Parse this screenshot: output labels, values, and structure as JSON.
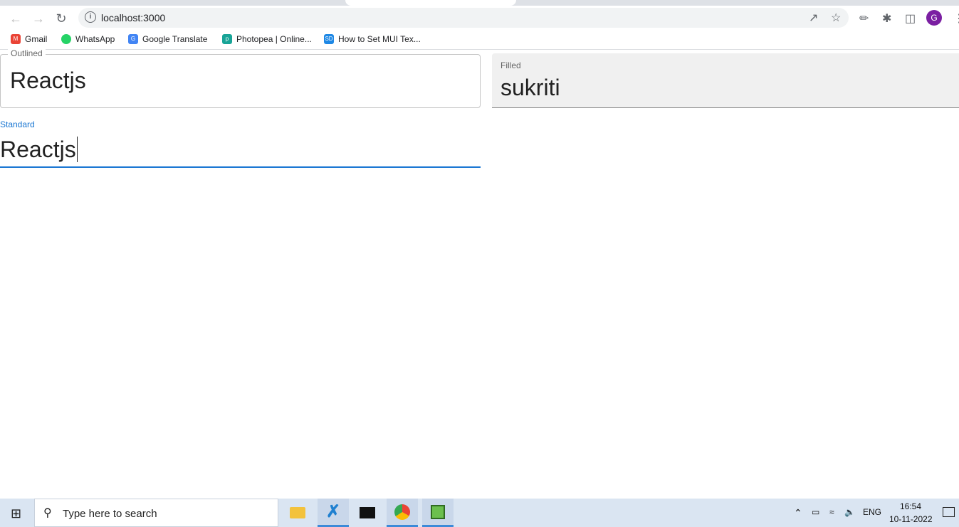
{
  "browser": {
    "url": "localhost:3000",
    "avatar_letter": "G",
    "bookmarks": [
      {
        "label": "Gmail",
        "icon": "gmail-icon",
        "color": "#ea4335"
      },
      {
        "label": "WhatsApp",
        "icon": "whatsapp-icon",
        "color": "#25d366"
      },
      {
        "label": "Google Translate",
        "icon": "google-translate-icon",
        "color": "#4285f4"
      },
      {
        "label": "Photopea | Online...",
        "icon": "photopea-icon",
        "color": "#18a497"
      },
      {
        "label": "How to Set MUI Tex...",
        "icon": "sd-icon",
        "color": "#1e88e5"
      }
    ]
  },
  "form": {
    "outlined": {
      "label": "Outlined",
      "value": "Reactjs"
    },
    "filled": {
      "label": "Filled",
      "value": "sukriti"
    },
    "standard": {
      "label": "Standard",
      "value": "Reactjs",
      "accent": "#1976d2"
    }
  },
  "taskbar": {
    "search_placeholder": "Type here to search",
    "language": "ENG",
    "time": "16:54",
    "date": "10-11-2022"
  }
}
